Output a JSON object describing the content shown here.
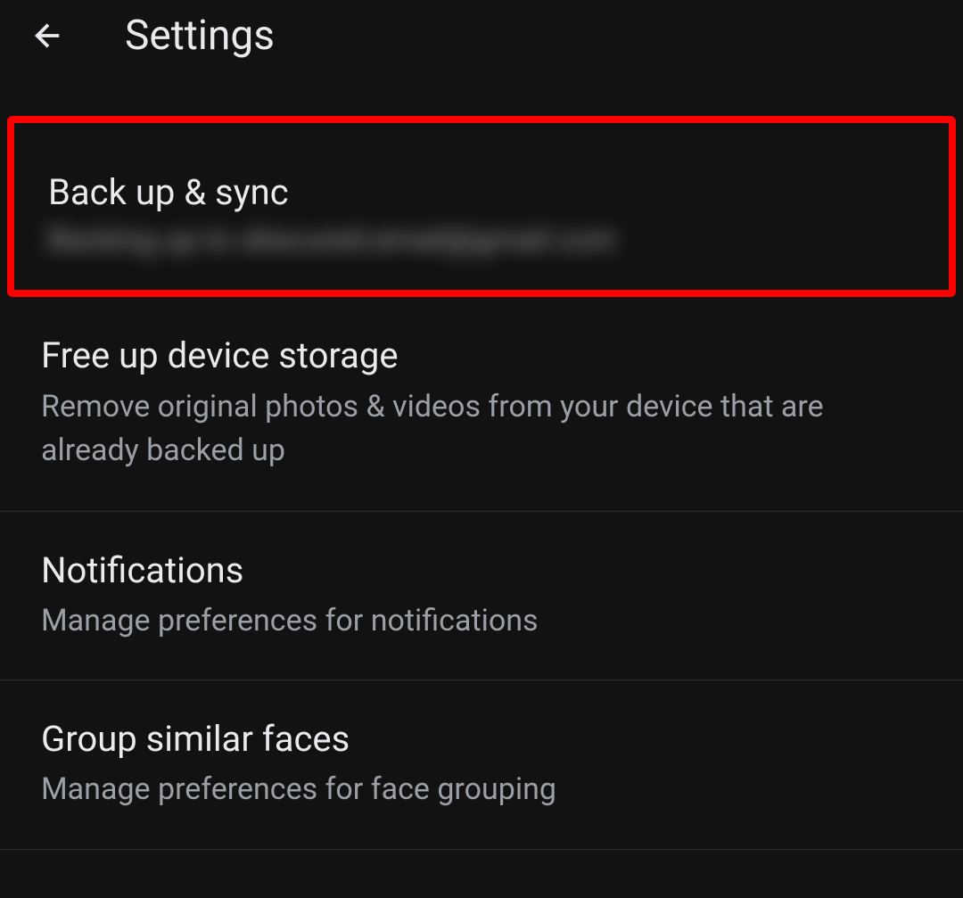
{
  "header": {
    "title": "Settings"
  },
  "settings": {
    "backup": {
      "title": "Back up & sync",
      "subtitle": "Backing up to obscured.email@gmail.com"
    },
    "freeup": {
      "title": "Free up device storage",
      "subtitle": "Remove original photos & videos from your device that are already backed up"
    },
    "notifications": {
      "title": "Notifications",
      "subtitle": "Manage preferences for notifications"
    },
    "groupfaces": {
      "title": "Group similar faces",
      "subtitle": "Manage preferences for face grouping"
    }
  }
}
